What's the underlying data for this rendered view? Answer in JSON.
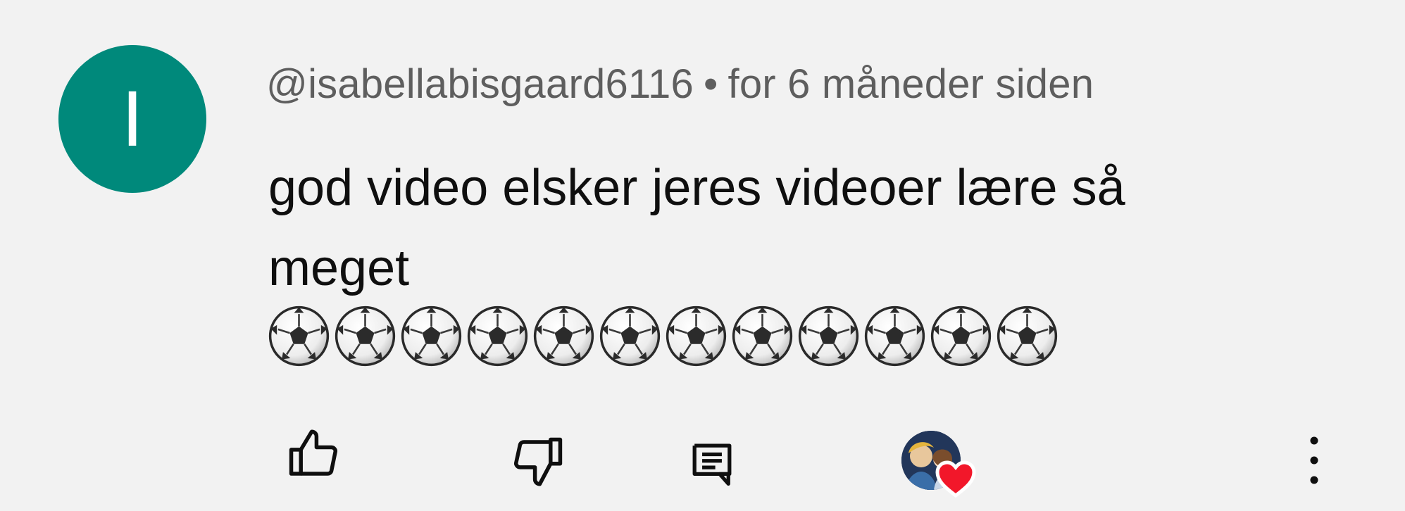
{
  "comment": {
    "avatar_letter": "I",
    "avatar_color": "#00897b",
    "author": "@isabellabisgaard6116",
    "separator": "•",
    "time_ago": "for 6 måneder siden",
    "text": "god video elsker jeres videoer lære så meget",
    "emoji": "⚽",
    "emoji_count": 12
  },
  "actions": {
    "like_icon": "thumbs-up-icon",
    "dislike_icon": "thumbs-down-icon",
    "reply_icon": "reply-comment-icon",
    "creator_heart_icon": "creator-heart-icon",
    "more_icon": "more-vertical-icon",
    "heart_color": "#f2172a"
  }
}
